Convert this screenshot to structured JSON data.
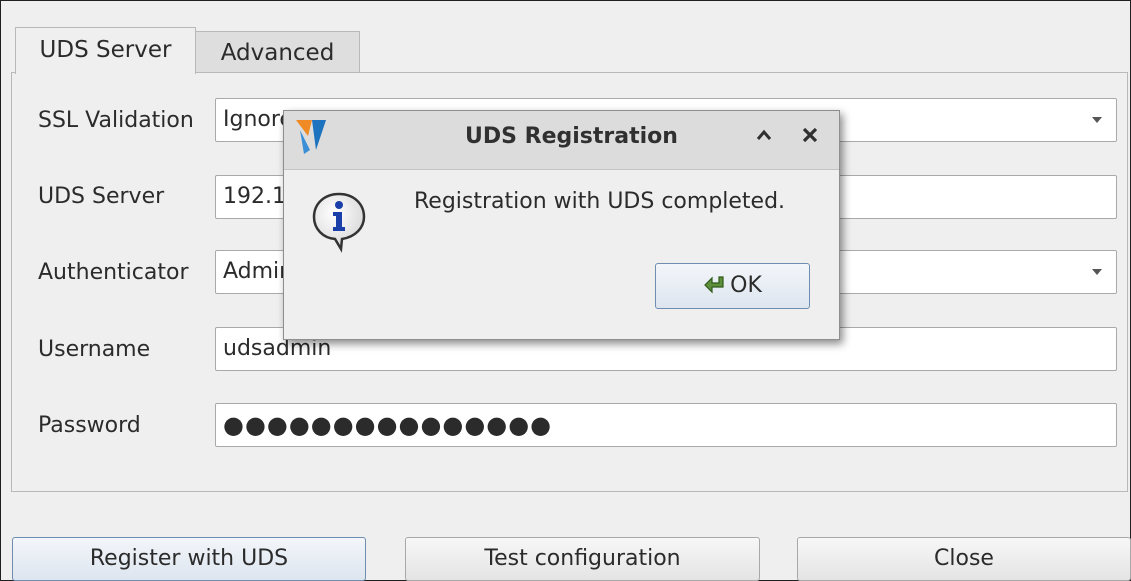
{
  "tabs": [
    {
      "label": "UDS Server",
      "active": true
    },
    {
      "label": "Advanced",
      "active": false
    }
  ],
  "form": {
    "ssl_validation": {
      "label": "SSL Validation",
      "value": "Ignore"
    },
    "uds_server": {
      "label": "UDS Server",
      "value": "192.168.1.10"
    },
    "authenticator": {
      "label": "Authenticator",
      "value": "Administration"
    },
    "username": {
      "label": "Username",
      "value": "udsadmin"
    },
    "password": {
      "label": "Password",
      "value": "●●●●●●●●●●●●●●●"
    }
  },
  "buttons": {
    "register": "Register with UDS",
    "test": "Test configuration",
    "close": "Close"
  },
  "dialog": {
    "title": "UDS Registration",
    "message": "Registration with UDS completed.",
    "ok_label": "OK",
    "icons": [
      "uds-logo-icon",
      "info-icon",
      "ok-arrow-icon",
      "minimize-icon",
      "close-icon"
    ]
  },
  "colors": {
    "dialog_titlebar": "#dcdcdc",
    "window_bg": "#efefef",
    "primary_button_border": "#6f8db0",
    "logo_orange": "#f08a24",
    "logo_blue": "#1e73be"
  }
}
